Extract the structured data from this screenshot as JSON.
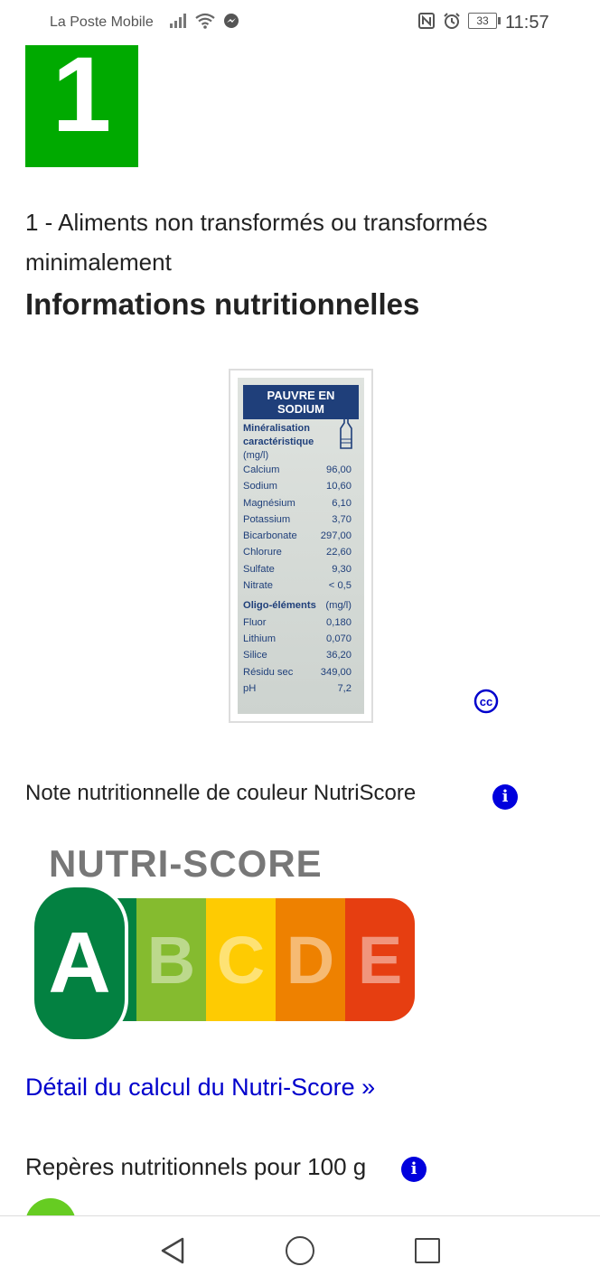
{
  "status_bar": {
    "carrier": "La Poste Mobile",
    "battery": "33",
    "time": "11:57"
  },
  "nova": {
    "group": "1",
    "description": "1 - Aliments non transformés ou transformés minimalement",
    "color": "#00aa00"
  },
  "nutrition": {
    "section_title": "Informations nutritionnelles",
    "label_image": {
      "header": "PAUVRE EN SODIUM",
      "subtitle_line1": "Minéralisation",
      "subtitle_line2": "caractéristique",
      "unit": "(mg/l)",
      "rows": [
        {
          "name": "Calcium",
          "value": "96,00"
        },
        {
          "name": "Sodium",
          "value": "10,60"
        },
        {
          "name": "Magnésium",
          "value": "6,10"
        },
        {
          "name": "Potassium",
          "value": "3,70"
        },
        {
          "name": "Bicarbonate",
          "value": "297,00"
        },
        {
          "name": "Chlorure",
          "value": "22,60"
        },
        {
          "name": "Sulfate",
          "value": "9,30"
        },
        {
          "name": "Nitrate",
          "value": "< 0,5"
        }
      ],
      "oligo_header": "Oligo-éléments",
      "oligo_unit": "(mg/l)",
      "oligo_rows": [
        {
          "name": "Fluor",
          "value": "0,180"
        },
        {
          "name": "Lithium",
          "value": "0,070"
        },
        {
          "name": "Silice",
          "value": "36,20"
        },
        {
          "name": "Résidu sec",
          "value": "349,00"
        },
        {
          "name": "pH",
          "value": "7,2"
        }
      ]
    },
    "cc_icon": "cc"
  },
  "nutriscore": {
    "label": "Note nutritionnelle de couleur NutriScore",
    "info_icon": "i",
    "logo_title": "NUTRI-SCORE",
    "grades": [
      "A",
      "B",
      "C",
      "D",
      "E"
    ],
    "selected_grade": "A",
    "colors": {
      "A": "#038141",
      "B": "#85bb2f",
      "C": "#fecb02",
      "D": "#ee8100",
      "E": "#e63e11"
    },
    "detail_link": "Détail du calcul du Nutri-Score »"
  },
  "reperes": {
    "label": "Repères nutritionnels pour 100 g",
    "info_icon": "i"
  }
}
